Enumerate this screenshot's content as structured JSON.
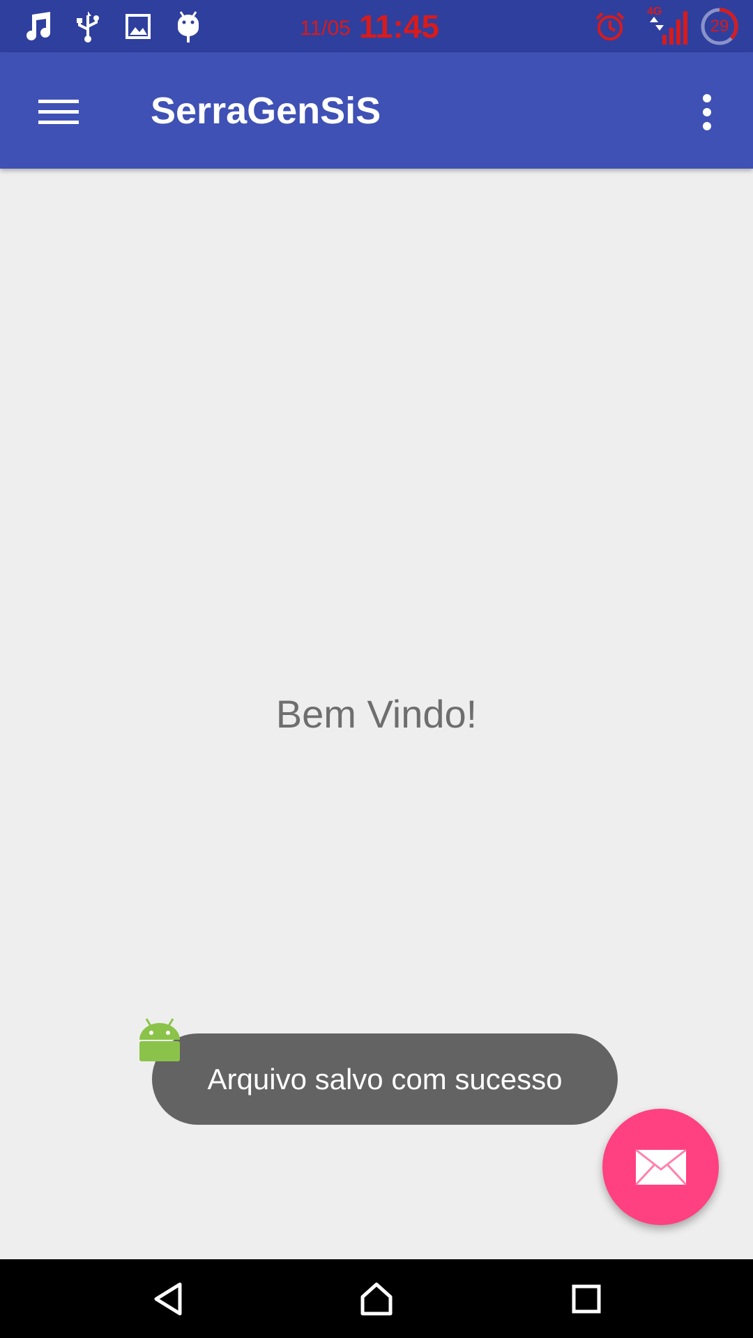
{
  "status_bar": {
    "date": "11/05",
    "time": "11:45",
    "network_type": "4G",
    "battery_level": "29",
    "left_icons": [
      "music-note-icon",
      "usb-icon",
      "image-icon",
      "android-debug-icon"
    ],
    "right_icons": [
      "alarm-icon",
      "signal-icon",
      "battery-icon"
    ],
    "clock_color": "#d81b1b"
  },
  "app_bar": {
    "title": "SerraGenSiS",
    "menu_icon": "hamburger-menu-icon",
    "overflow_icon": "more-vert-icon",
    "color": "#3f51b5"
  },
  "main": {
    "welcome_text": "Bem Vindo!"
  },
  "toast": {
    "message": "Arquivo salvo com sucesso"
  },
  "fab": {
    "icon": "mail-icon",
    "color": "#ff4081"
  },
  "nav_bar": {
    "buttons": [
      "back-icon",
      "home-icon",
      "recents-icon"
    ]
  }
}
